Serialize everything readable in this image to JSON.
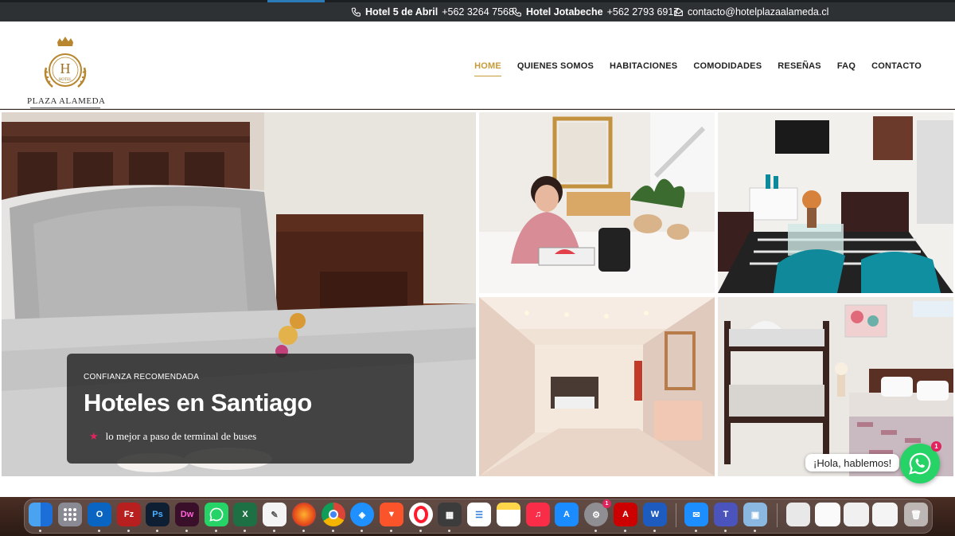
{
  "topbar": {
    "contact1_name": "Hotel 5 de Abril",
    "contact1_phone": "+562 3264 7568",
    "contact2_name": "Hotel Jotabeche",
    "contact2_phone": "+562 2793 6917",
    "email": "contacto@hotelplazaalameda.cl"
  },
  "logo": {
    "letter": "H",
    "small": "HOTEL",
    "name": "PLAZA ALAMEDA"
  },
  "nav": {
    "items": [
      "HOME",
      "QUIENES SOMOS",
      "HABITACIONES",
      "COMODIDADES",
      "RESEÑAS",
      "FAQ",
      "CONTACTO"
    ],
    "active": "HOME",
    "active_color": "#c79a3a"
  },
  "hero": {
    "kicker": "CONFIANZA RECOMENDADA",
    "title": "Hoteles en Santiago",
    "subtitle": "lo mejor a paso de terminal de buses"
  },
  "chat": {
    "bubble": "¡Hola, hablemos!",
    "badge": "1",
    "color": "#25d366"
  },
  "dock": {
    "apps": [
      "finder-icon",
      "launchpad-icon",
      "outlook-icon",
      "filezilla-icon",
      "photoshop-icon",
      "dreamweaver-icon",
      "whatsapp-icon",
      "excel-icon",
      "textedit-icon",
      "firefox-icon",
      "chrome-icon",
      "safari-icon",
      "brave-icon",
      "opera-icon",
      "calculator-icon",
      "reminders-icon",
      "notes-icon",
      "music-icon",
      "app-store-icon",
      "system-settings-icon",
      "acrobat-icon",
      "word-icon",
      "mail-icon",
      "teams-icon",
      "preview-icon"
    ],
    "settings_badge": "1"
  }
}
